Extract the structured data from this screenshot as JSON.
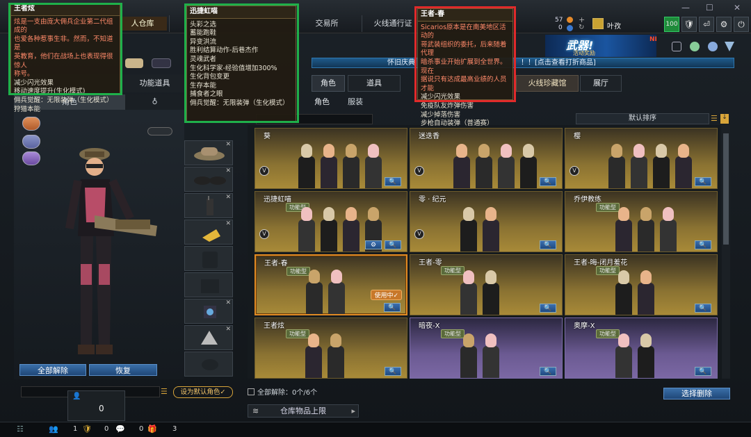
{
  "nav": {
    "tab_warehouse": "人仓库",
    "tab_exchange": "交易所",
    "tab_pass": "火线通行证"
  },
  "top": {
    "count1": "57",
    "count2": "0",
    "username": "叶孜",
    "level": "100"
  },
  "banner": {
    "title": "武器!",
    "sub": "活动奖励",
    "new": "NEW"
  },
  "notice": {
    "left": "怀旧庆典",
    "right": "！！[点击查看打折商品]"
  },
  "left_tabs": {
    "functional": "功能道具",
    "character": "角色"
  },
  "left_buttons": {
    "unequip_all": "全部解除",
    "restore": "恢复",
    "default_role": "设为默认角色✓",
    "count": "0"
  },
  "main_tabs": {
    "character": "角色",
    "props": "道具",
    "sub_character": "角色",
    "sub_outfit": "服装",
    "collection": "火线珍藏馆",
    "hall": "展厅"
  },
  "sort": {
    "label": "默认排序"
  },
  "cards": [
    {
      "name": "葵",
      "tag": ""
    },
    {
      "name": "迷迭香",
      "tag": ""
    },
    {
      "name": "樱",
      "tag": ""
    },
    {
      "name": "迅捷虹喵",
      "tag": "功能型"
    },
    {
      "name": "零 · 纪元",
      "tag": ""
    },
    {
      "name": "乔伊教练",
      "tag": "功能型"
    },
    {
      "name": "王者-春",
      "tag": "功能型",
      "status": "使用中✓"
    },
    {
      "name": "王者-零",
      "tag": "功能型"
    },
    {
      "name": "王者-晦-闭月羞花",
      "tag": "功能型"
    },
    {
      "name": "王者炫",
      "tag": "功能型"
    },
    {
      "name": "暗夜-X",
      "tag": "功能型"
    },
    {
      "name": "奥摩-X",
      "tag": "功能型"
    }
  ],
  "footer": {
    "unequip_status": "全部解除：0个/6个",
    "select_delete": "选择删除",
    "storage_limit": "仓库物品上限"
  },
  "bottombar": {
    "v1": "1",
    "v2": "0",
    "v3": "0",
    "v4": "3"
  },
  "tooltip_left": {
    "title": "王者炫",
    "lines": [
      "炫是一支由庞大佣兵企业第二代组成的",
      "也爱各种惹事生非。然而，不知道是",
      "英教育，他们在战场上也表现得很惊人",
      "称号。"
    ],
    "effects": [
      "减少闪光效果",
      "移动速度提升(生化模式)",
      "佣兵觉醒：无限装弹（生化模式）",
      "狩猎本能"
    ]
  },
  "tooltip_mid": {
    "title": "迅捷虹喵",
    "effects": [
      "头彩之选",
      "蓄能跑鞋",
      "异变洪流",
      "胜利结算动作-后巷杰作",
      "灵魂武者",
      "生化科学家-经验值增加300%",
      "生化背包变更",
      "生存本能",
      "捕食者之眼",
      "佣兵觉醒：无限装弹（生化模式）"
    ]
  },
  "tooltip_right": {
    "title": "王者-春",
    "lines": [
      "Sicarios原本是在南美地区活动的",
      "哥武装组织的委托，后来随着代理",
      "暗杀事业开始扩展到全世界。现在",
      "据说只有达成最高业绩的人员才能"
    ],
    "effects": [
      "减少闪光效果",
      "免疫队友炸弹伤害",
      "减少掉落伤害",
      "步枪自动装弹（普通赛）"
    ]
  }
}
